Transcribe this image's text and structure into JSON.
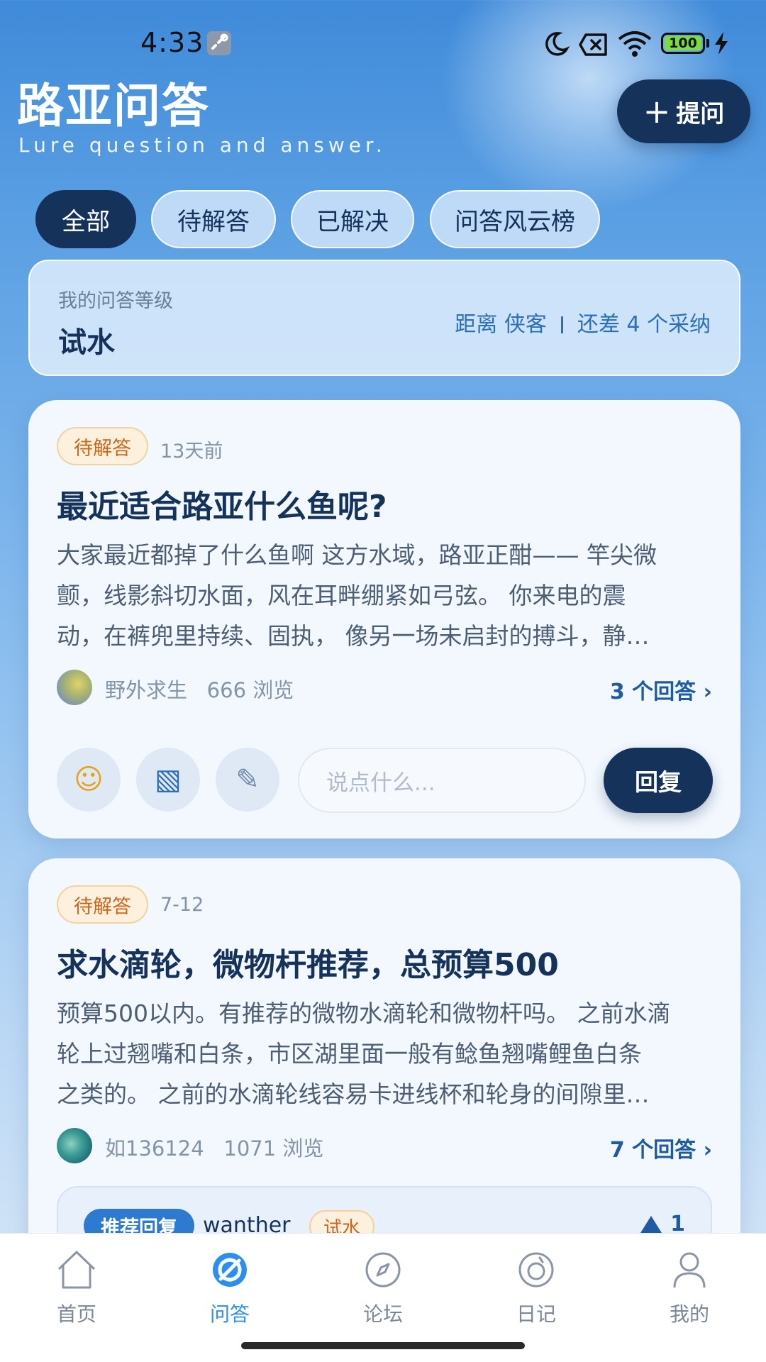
{
  "status_bar": {
    "time": "4:33",
    "battery": "100"
  },
  "header": {
    "title": "路亚问答",
    "subtitle": "Lure question and answer.",
    "ask_button": {
      "icon": "plus-icon",
      "label": "提问"
    }
  },
  "tabs": [
    {
      "label": "全部",
      "active": true
    },
    {
      "label": "待解答",
      "active": false
    },
    {
      "label": "已解决",
      "active": false
    },
    {
      "label": "问答风云榜",
      "active": false
    }
  ],
  "level_card": {
    "caption": "我的问答等级",
    "level": "试水",
    "next_level_text": "距离 侠客",
    "remaining_text": "还差 4 个采纳"
  },
  "questions": [
    {
      "status": "待解答",
      "time": "13天前",
      "title": "最近适合路亚什么鱼呢?",
      "body_lines": [
        "大家最近都掉了什么鱼啊 这方水域，路亚正酣—— 竿尖微",
        "颤，线影斜切水面，风在耳畔绷紧如弓弦。 你来电的震",
        "动，在裤兜里持续、固执， 像另一场未启封的搏斗，静…"
      ],
      "author": "野外求生",
      "views": "666 浏览",
      "answers": "3 个回答 ›",
      "actions": {
        "emoji_icon": "☺",
        "image_icon": "▧",
        "edit_icon": "✎",
        "input_placeholder": "说点什么...",
        "reply_label": "回复"
      }
    },
    {
      "status": "待解答",
      "time": "7-12",
      "title": "求水滴轮，微物杆推荐，总预算500",
      "body_lines": [
        "预算500以内。有推荐的微物水滴轮和微物杆吗。 之前水滴",
        "轮上过翘嘴和白条，市区湖里面一般有鲶鱼翘嘴鲤鱼白条",
        "之类的。 之前的水滴轮线容易卡进线杯和轮身的间隙里…"
      ],
      "author": "如136124",
      "views": "1071 浏览",
      "answers": "7 个回答 ›",
      "recommended": {
        "tag": "推荐回复",
        "user": "wanther",
        "level": "试水",
        "likes": "1"
      }
    }
  ],
  "bottom_nav": [
    {
      "label": "首页",
      "icon": "home-icon",
      "active": false
    },
    {
      "label": "问答",
      "icon": "qa-icon",
      "active": true
    },
    {
      "label": "论坛",
      "icon": "compass-icon",
      "active": false
    },
    {
      "label": "日记",
      "icon": "diary-icon",
      "active": false
    },
    {
      "label": "我的",
      "icon": "profile-icon",
      "active": false
    }
  ],
  "colors": {
    "primary_dark": "#15325b",
    "accent_blue": "#2b8ff0",
    "badge_orange": "#c9671e"
  }
}
